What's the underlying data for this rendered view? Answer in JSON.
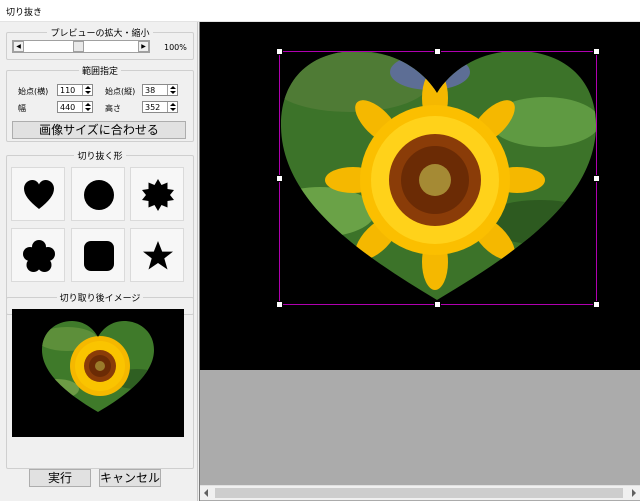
{
  "window": {
    "title": "切り抜き"
  },
  "preview_zoom": {
    "legend": "プレビューの拡大・縮小",
    "value_text": "100%"
  },
  "range": {
    "legend": "範囲指定",
    "start_x_label": "始点(横)",
    "start_x": "110",
    "start_y_label": "始点(縦)",
    "start_y": "38",
    "width_label": "幅",
    "width": "440",
    "height_label": "高さ",
    "height": "352",
    "fit_button": "画像サイズに合わせる"
  },
  "shapes": {
    "legend": "切り抜く形",
    "items": [
      "heart-icon",
      "circle-icon",
      "badge-burst-icon",
      "flower-icon",
      "rounded-square-icon",
      "star-icon"
    ]
  },
  "result": {
    "legend": "切り取り後イメージ"
  },
  "actions": {
    "run": "実行",
    "cancel": "キャンセル"
  },
  "colors": {
    "selection": "#b000b0",
    "sunflower": "#f5b800",
    "leaf": "#3f7a2a"
  }
}
